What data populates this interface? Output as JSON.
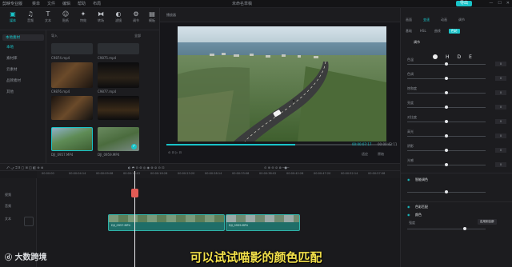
{
  "app": {
    "name": "剪映专业版",
    "menus": [
      "菜单",
      "文件",
      "编辑",
      "帮助",
      "布局"
    ],
    "window_title": "未命名草稿",
    "export_label": "导出",
    "window_buttons": [
      "—",
      "☐",
      "✕"
    ]
  },
  "toolbar": {
    "tools": [
      {
        "label": "媒体",
        "icon": "media-icon"
      },
      {
        "label": "音频",
        "icon": "audio-icon"
      },
      {
        "label": "文本",
        "icon": "text-icon"
      },
      {
        "label": "贴纸",
        "icon": "sticker-icon"
      },
      {
        "label": "特效",
        "icon": "effects-icon"
      },
      {
        "label": "转场",
        "icon": "transition-icon"
      },
      {
        "label": "滤镜",
        "icon": "filter-icon"
      },
      {
        "label": "调节",
        "icon": "adjust-icon"
      },
      {
        "label": "模板",
        "icon": "template-icon"
      }
    ]
  },
  "leftnav": {
    "items": [
      "本地素材",
      "本地",
      "素材库",
      "云素材",
      "品牌素材",
      "其他"
    ]
  },
  "media": {
    "import_label": "导入",
    "filter_label": "全部",
    "clips": [
      {
        "name": "C9874.mp4"
      },
      {
        "name": "C9875.mp4"
      },
      {
        "name": "C9876.mp4"
      },
      {
        "name": "C9877.mp4"
      },
      {
        "name": "DJI_0957.MP4",
        "tag": "已添加"
      },
      {
        "name": "DJI_0959.MP4",
        "tag": "已添加"
      }
    ]
  },
  "player": {
    "title": "播放器",
    "time_current": "00:00:07:17",
    "time_total": "00:00:42:11",
    "controls": {
      "fit": "适应",
      "original": "原始"
    }
  },
  "rightpanel": {
    "tabs": [
      "画面",
      "变速",
      "动画",
      "调节"
    ],
    "subtabs": [
      "基础",
      "HSL",
      "曲线",
      "色轮"
    ],
    "sections": [
      {
        "title": "调节",
        "sliders": [
          {
            "label": "色温",
            "value": "0"
          },
          {
            "label": "色调",
            "value": "0"
          },
          {
            "label": "饱和度",
            "value": "0"
          },
          {
            "label": "亮度",
            "value": "0"
          },
          {
            "label": "对比度",
            "value": "0"
          },
          {
            "label": "高光",
            "value": "0"
          },
          {
            "label": "阴影",
            "value": "0"
          },
          {
            "label": "光感",
            "value": "0"
          }
        ]
      },
      {
        "title": "智能调色"
      },
      {
        "title": "色彩匹配"
      },
      {
        "title": "颜色"
      },
      {
        "title": "强度"
      }
    ],
    "hsl_options": [
      "H",
      "D",
      "E"
    ],
    "match_button": "应用到全部",
    "strength_label": "强度"
  },
  "timeline": {
    "ruler": [
      "00:00:00",
      "00:00:04:14",
      "00:00:09:08",
      "00:00:14:02",
      "00:00:18:26",
      "00:00:23:20",
      "00:00:28:14",
      "00:00:33:08",
      "00:00:38:02",
      "00:00:42:26",
      "00:00:47:20",
      "00:00:52:14",
      "00:00:57:08"
    ],
    "tracks": [
      "视频",
      "音频",
      "文本"
    ],
    "clip_a": "DJI_0957.MP4",
    "clip_b": "DJI_0959.MP4"
  },
  "overlay": {
    "subtitle": "可以试试喵影的颜色匹配",
    "brand": "大数跨境"
  },
  "colors": {
    "accent": "#19c3c8",
    "subtitle": "#f2e04a",
    "clip": "#1f6e68",
    "playhead": "#e25b55"
  }
}
